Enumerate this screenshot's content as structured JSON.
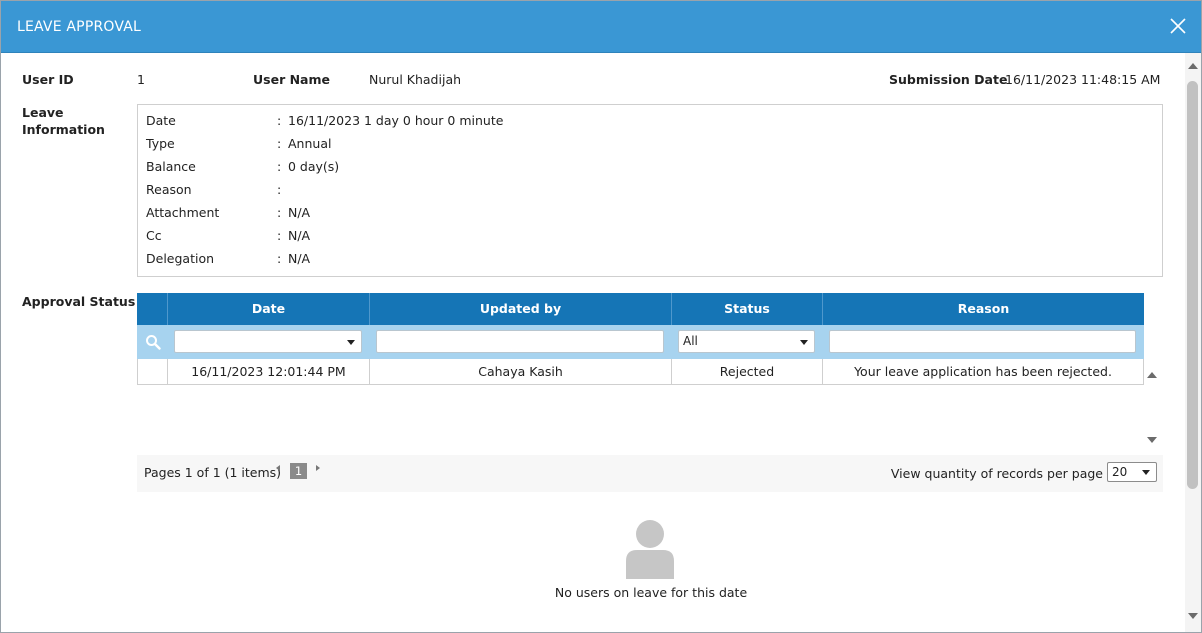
{
  "dialog": {
    "title": "LEAVE APPROVAL"
  },
  "header": {
    "user_id_label": "User ID",
    "user_id": "1",
    "user_name_label": "User Name",
    "user_name": "Nurul Khadijah",
    "submission_date_label": "Submission Date",
    "submission_date": "16/11/2023 11:48:15 AM"
  },
  "leave_info": {
    "label_line1": "Leave",
    "label_line2": "Information",
    "rows": [
      {
        "key": "Date",
        "value": "16/11/2023",
        "extra": "1 day 0 hour 0 minute"
      },
      {
        "key": "Type",
        "value": "Annual"
      },
      {
        "key": "Balance",
        "value": "0 day(s)"
      },
      {
        "key": "Reason",
        "value": ""
      },
      {
        "key": "Attachment",
        "value": "N/A"
      },
      {
        "key": "Cc",
        "value": "N/A"
      },
      {
        "key": "Delegation",
        "value": "N/A"
      }
    ],
    "separator": ":"
  },
  "approval": {
    "label": "Approval Status",
    "columns": [
      "Date",
      "Updated by",
      "Status",
      "Reason"
    ],
    "filters": {
      "date": "",
      "updated_by": "",
      "status": "All",
      "reason": ""
    },
    "rows": [
      {
        "date": "16/11/2023 12:01:44 PM",
        "updated_by": "Cahaya Kasih",
        "status": "Rejected",
        "reason": "Your leave application has been rejected."
      }
    ]
  },
  "pager": {
    "info": "Pages 1 of 1 (1 items)",
    "current_page": "1",
    "per_page_label": "View quantity of records per page",
    "per_page": "20"
  },
  "empty_state": {
    "message": "No users on leave for this date"
  }
}
